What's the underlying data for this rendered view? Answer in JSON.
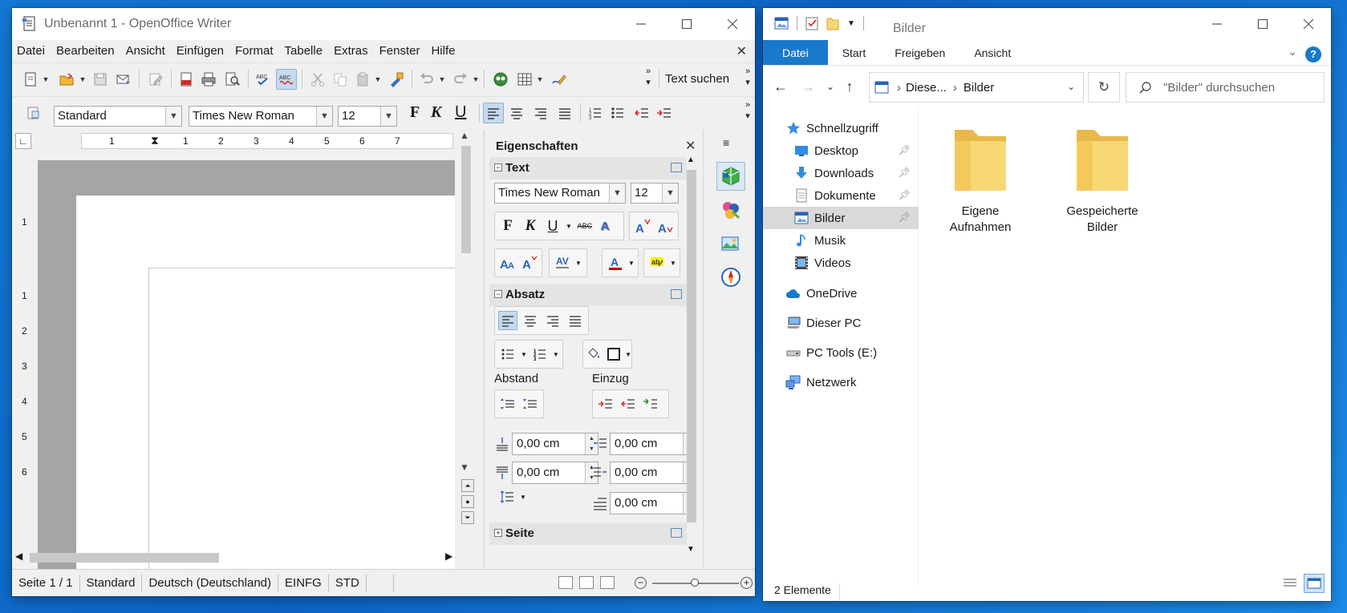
{
  "writer": {
    "title": "Unbenannt 1 - OpenOffice Writer",
    "menu": [
      "Datei",
      "Bearbeiten",
      "Ansicht",
      "Einfügen",
      "Format",
      "Tabelle",
      "Extras",
      "Fenster",
      "Hilfe"
    ],
    "find_label": "Text suchen",
    "style_value": "Standard",
    "font_value": "Times New Roman",
    "size_value": "12",
    "bold_label": "F",
    "italic_label": "K",
    "underline_label": "U",
    "ruler_h": [
      "1",
      "1",
      "2",
      "3",
      "4",
      "5",
      "6",
      "7"
    ],
    "ruler_v": [
      "1",
      "1",
      "2",
      "3",
      "4",
      "5",
      "6"
    ],
    "sidebar": {
      "title": "Eigenschaften",
      "text_section": "Text",
      "font_value": "Times New Roman",
      "size_value": "12",
      "para_section": "Absatz",
      "spacing_label": "Abstand",
      "indent_label": "Einzug",
      "above_value": "0,00 cm",
      "below_value": "0,00 cm",
      "before_text_value": "0,00 cm",
      "after_text_value": "0,00 cm",
      "first_line_value": "0,00 cm",
      "page_section": "Seite"
    },
    "status": {
      "page": "Seite 1 / 1",
      "style": "Standard",
      "language": "Deutsch (Deutschland)",
      "insert_mode": "EINFG",
      "selection_mode": "STD"
    }
  },
  "explorer": {
    "title": "Bilder",
    "ribbon_tabs": [
      "Datei",
      "Start",
      "Freigeben",
      "Ansicht"
    ],
    "help_label": "?",
    "breadcrumb": [
      "Diese...",
      "Bilder"
    ],
    "search_placeholder": "\"Bilder\" durchsuchen",
    "quick_access": "Schnellzugriff",
    "nav_items": [
      "Desktop",
      "Downloads",
      "Dokumente",
      "Bilder",
      "Musik",
      "Videos"
    ],
    "onedrive": "OneDrive",
    "this_pc": "Dieser PC",
    "pc_tools": "PC Tools (E:)",
    "network": "Netzwerk",
    "folders": [
      {
        "line1": "Eigene",
        "line2": "Aufnahmen"
      },
      {
        "line1": "Gespeicherte",
        "line2": "Bilder"
      }
    ],
    "status_count": "2 Elemente"
  },
  "colors": {
    "desktop": "#0d63c4",
    "explorer_accent": "#1979ca",
    "folder_yellow": "#f8d775",
    "selection_blue": "#c5d9ee"
  }
}
